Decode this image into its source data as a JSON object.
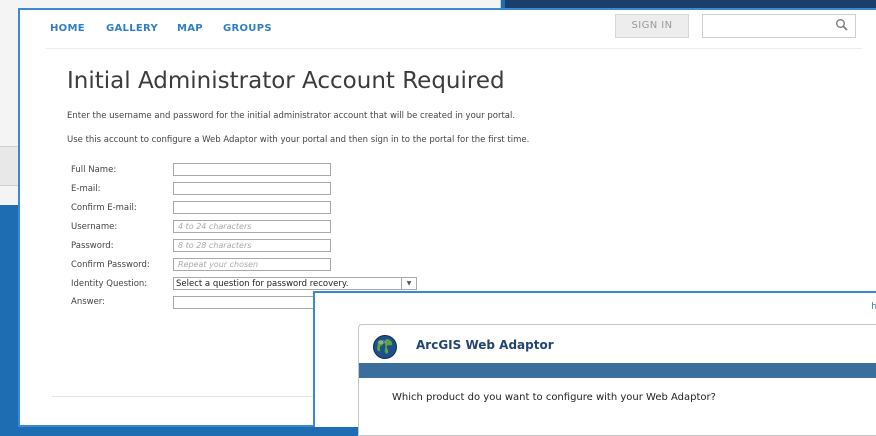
{
  "nav": {
    "items": [
      "HOME",
      "GALLERY",
      "MAP",
      "GROUPS"
    ],
    "sign_in": "SIGN IN",
    "search_value": ""
  },
  "page": {
    "title": "Initial Administrator Account Required",
    "para1": "Enter the username and password for the initial administrator account that will be created in your portal.",
    "para2": "Use this account to configure a Web Adaptor with your portal and then sign in to the portal for the first time."
  },
  "form": {
    "full_name": {
      "label": "Full Name:",
      "value": "",
      "placeholder": ""
    },
    "email": {
      "label": "E-mail:",
      "value": "",
      "placeholder": ""
    },
    "confirm_email": {
      "label": "Confirm E-mail:",
      "value": "",
      "placeholder": ""
    },
    "username": {
      "label": "Username:",
      "value": "",
      "placeholder": "4 to 24 characters"
    },
    "password": {
      "label": "Password:",
      "value": "",
      "placeholder": "8 to 28 characters"
    },
    "confirm_password": {
      "label": "Confirm Password:",
      "value": "",
      "placeholder": "Repeat your chosen"
    },
    "identity_question": {
      "label": "Identity Question:",
      "selected": "Select a question for password recovery."
    },
    "answer": {
      "label": "Answer:",
      "value": ""
    }
  },
  "web_adaptor": {
    "corner_text": "h",
    "title": "ArcGIS Web Adaptor",
    "question": "Which product do you want to configure with your Web Adaptor?"
  },
  "colors": {
    "nav_link": "#2f7fc5",
    "desktop_blue": "#1e6db3",
    "dialog_bar": "#3a6e9c",
    "dialog_title": "#22466f"
  }
}
